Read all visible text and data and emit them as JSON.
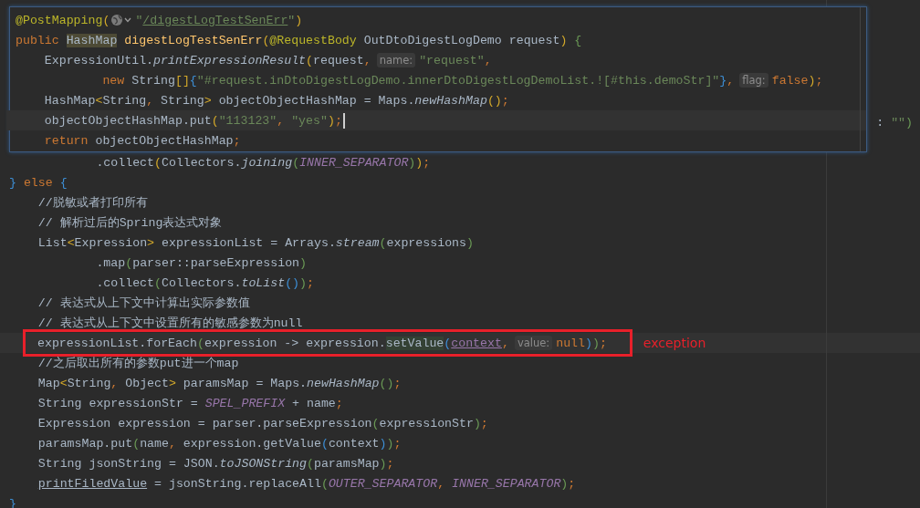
{
  "popup": {
    "lines": [
      {
        "current": false,
        "cursor": false,
        "parts": [
          {
            "kind": "code",
            "tokens": [
              {
                "text": "@PostMapping",
                "kind": "ann"
              },
              {
                "text": "(",
                "kind": "by"
              }
            ]
          },
          {
            "kind": "icon"
          },
          {
            "kind": "code",
            "tokens": [
              {
                "text": "\"",
                "kind": "str"
              },
              {
                "text": "/digestLogTestSenErr",
                "kind": "stru"
              },
              {
                "text": "\"",
                "kind": "str"
              },
              {
                "text": ")",
                "kind": "by"
              }
            ]
          }
        ]
      },
      {
        "current": false,
        "cursor": false,
        "parts": [
          {
            "kind": "code",
            "tokens": [
              {
                "text": "public ",
                "kind": "kw"
              },
              {
                "text": "HashMap",
                "kind": "hl"
              },
              {
                "text": " digestLogTestSenErr",
                "kind": "fn"
              },
              {
                "text": "(",
                "kind": "by"
              },
              {
                "text": "@RequestBody",
                "kind": "ann"
              },
              {
                "text": " OutDtoDigestLogDemo request",
                "kind": "plain"
              },
              {
                "text": ")",
                "kind": "by"
              },
              {
                "text": " {",
                "kind": "bg"
              }
            ]
          }
        ]
      },
      {
        "current": false,
        "cursor": false,
        "parts": [
          {
            "kind": "code",
            "tokens": [
              {
                "text": "    ExpressionUtil.",
                "kind": "plain"
              },
              {
                "text": "printExpressionResult",
                "kind": "it"
              },
              {
                "text": "(",
                "kind": "by"
              },
              {
                "text": "request",
                "kind": "plain"
              },
              {
                "text": ",",
                "kind": "kw"
              }
            ]
          },
          {
            "kind": "hint",
            "text": "name:"
          },
          {
            "kind": "code",
            "tokens": [
              {
                "text": "\"request\"",
                "kind": "str"
              },
              {
                "text": ",",
                "kind": "kw"
              }
            ]
          }
        ]
      },
      {
        "current": false,
        "cursor": false,
        "parts": [
          {
            "kind": "code",
            "tokens": [
              {
                "text": "            new",
                "kind": "kw"
              },
              {
                "text": " String",
                "kind": "plain"
              },
              {
                "text": "[]",
                "kind": "by"
              },
              {
                "text": "{",
                "kind": "bb"
              },
              {
                "text": "\"#request.inDtoDigestLogDemo.innerDtoDigestLogDemoList.![#this.demoStr]\"",
                "kind": "str"
              },
              {
                "text": "}",
                "kind": "bb"
              },
              {
                "text": ",",
                "kind": "kw"
              }
            ]
          },
          {
            "kind": "hint",
            "text": "flag:"
          },
          {
            "kind": "code",
            "tokens": [
              {
                "text": "false",
                "kind": "kw"
              },
              {
                "text": ")",
                "kind": "by"
              },
              {
                "text": ";",
                "kind": "kw"
              }
            ]
          }
        ]
      },
      {
        "current": false,
        "cursor": false,
        "parts": [
          {
            "kind": "code",
            "tokens": [
              {
                "text": "    HashMap",
                "kind": "plain"
              },
              {
                "text": "<",
                "kind": "by"
              },
              {
                "text": "String",
                "kind": "plain"
              },
              {
                "text": ", ",
                "kind": "kw"
              },
              {
                "text": "String",
                "kind": "plain"
              },
              {
                "text": ">",
                "kind": "by"
              },
              {
                "text": " objectObjectHashMap = Maps.",
                "kind": "plain"
              },
              {
                "text": "newHashMap",
                "kind": "it"
              },
              {
                "text": "()",
                "kind": "by"
              },
              {
                "text": ";",
                "kind": "kw"
              }
            ]
          }
        ]
      },
      {
        "current": true,
        "cursor": true,
        "parts": [
          {
            "kind": "code",
            "tokens": [
              {
                "text": "    objectObjectHashMap.put",
                "kind": "plain"
              },
              {
                "text": "(",
                "kind": "by"
              },
              {
                "text": "\"113123\"",
                "kind": "str"
              },
              {
                "text": ", ",
                "kind": "kw"
              },
              {
                "text": "\"yes\"",
                "kind": "str"
              },
              {
                "text": ")",
                "kind": "by"
              },
              {
                "text": ";",
                "kind": "kw"
              }
            ]
          }
        ]
      },
      {
        "current": false,
        "cursor": false,
        "parts": [
          {
            "kind": "code",
            "tokens": [
              {
                "text": "    return",
                "kind": "kw"
              },
              {
                "text": " objectObjectHashMap",
                "kind": "plain"
              },
              {
                "text": ";",
                "kind": "kw"
              }
            ]
          }
        ]
      }
    ]
  },
  "code": [
    {
      "kind": "fragment",
      "current": false,
      "parts": [
        {
          "kind": "code",
          "tokens": [
            {
              "text": ": ",
              "kind": "plain"
            },
            {
              "text": "\"\"",
              "kind": "str"
            },
            {
              "text": ")",
              "kind": "bg"
            }
          ]
        }
      ]
    },
    {
      "kind": "blank",
      "current": false
    },
    {
      "kind": "code",
      "current": false,
      "parts": [
        {
          "kind": "code",
          "tokens": [
            {
              "text": "            .collect",
              "kind": "plain"
            },
            {
              "text": "(",
              "kind": "by"
            },
            {
              "text": "Collectors.",
              "kind": "plain"
            },
            {
              "text": "joining",
              "kind": "it"
            },
            {
              "text": "(",
              "kind": "bg"
            },
            {
              "text": "INNER_SEPARATOR",
              "kind": "const"
            },
            {
              "text": ")",
              "kind": "bg"
            },
            {
              "text": ")",
              "kind": "by"
            },
            {
              "text": ";",
              "kind": "kw"
            }
          ]
        }
      ]
    },
    {
      "kind": "code",
      "current": false,
      "parts": [
        {
          "kind": "code",
          "tokens": [
            {
              "text": "}",
              "kind": "bb"
            },
            {
              "text": " else ",
              "kind": "kw"
            },
            {
              "text": "{",
              "kind": "bb"
            }
          ]
        }
      ]
    },
    {
      "kind": "code",
      "current": false,
      "parts": [
        {
          "kind": "code",
          "tokens": [
            {
              "text": "    //脱敏或者打印所有",
              "kind": "cmt"
            }
          ]
        }
      ]
    },
    {
      "kind": "code",
      "current": false,
      "parts": [
        {
          "kind": "code",
          "tokens": [
            {
              "text": "    // 解析过后的Spring表达式对象",
              "kind": "cmt"
            }
          ]
        }
      ]
    },
    {
      "kind": "code",
      "current": false,
      "parts": [
        {
          "kind": "code",
          "tokens": [
            {
              "text": "    List",
              "kind": "plain"
            },
            {
              "text": "<",
              "kind": "by"
            },
            {
              "text": "Expression",
              "kind": "plain"
            },
            {
              "text": ">",
              "kind": "by"
            },
            {
              "text": " expressionList = Arrays.",
              "kind": "plain"
            },
            {
              "text": "stream",
              "kind": "it"
            },
            {
              "text": "(",
              "kind": "bg"
            },
            {
              "text": "expressions",
              "kind": "plain"
            },
            {
              "text": ")",
              "kind": "bg"
            }
          ]
        }
      ]
    },
    {
      "kind": "code",
      "current": false,
      "parts": [
        {
          "kind": "code",
          "tokens": [
            {
              "text": "            .map",
              "kind": "plain"
            },
            {
              "text": "(",
              "kind": "bg"
            },
            {
              "text": "parser::parseExpression",
              "kind": "plain"
            },
            {
              "text": ")",
              "kind": "bg"
            }
          ]
        }
      ]
    },
    {
      "kind": "code",
      "current": false,
      "parts": [
        {
          "kind": "code",
          "tokens": [
            {
              "text": "            .collect",
              "kind": "plain"
            },
            {
              "text": "(",
              "kind": "bg"
            },
            {
              "text": "Collectors.",
              "kind": "plain"
            },
            {
              "text": "toList",
              "kind": "it"
            },
            {
              "text": "()",
              "kind": "bb"
            },
            {
              "text": ")",
              "kind": "bg"
            },
            {
              "text": ";",
              "kind": "kw"
            }
          ]
        }
      ]
    },
    {
      "kind": "code",
      "current": false,
      "parts": [
        {
          "kind": "code",
          "tokens": [
            {
              "text": "    // 表达式从上下文中计算出实际参数值",
              "kind": "cmt"
            }
          ]
        }
      ]
    },
    {
      "kind": "code",
      "current": false,
      "parts": [
        {
          "kind": "code",
          "tokens": [
            {
              "text": "    // 表达式从上下文中设置所有的敏感参数为null",
              "kind": "cmt"
            }
          ]
        }
      ]
    },
    {
      "kind": "flagged",
      "current": true,
      "note": "exception",
      "parts": [
        {
          "kind": "code",
          "tokens": [
            {
              "text": "expressionList.forEach",
              "kind": "plain"
            },
            {
              "text": "(",
              "kind": "bg"
            },
            {
              "text": "expression -> expression.",
              "kind": "plain"
            },
            {
              "text": "setValue",
              "kind": "sel"
            },
            {
              "text": "(",
              "kind": "bb"
            },
            {
              "text": "context",
              "kind": "field"
            },
            {
              "text": ",",
              "kind": "kw"
            }
          ]
        },
        {
          "kind": "hint",
          "text": "value:"
        },
        {
          "kind": "code",
          "tokens": [
            {
              "text": "null",
              "kind": "kw"
            },
            {
              "text": ")",
              "kind": "bb"
            },
            {
              "text": ")",
              "kind": "bg"
            },
            {
              "text": ";",
              "kind": "kw"
            }
          ]
        }
      ]
    },
    {
      "kind": "code",
      "current": false,
      "parts": [
        {
          "kind": "code",
          "tokens": [
            {
              "text": "    //之后取出所有的参数put进一个map",
              "kind": "cmt"
            }
          ]
        }
      ]
    },
    {
      "kind": "code",
      "current": false,
      "parts": [
        {
          "kind": "code",
          "tokens": [
            {
              "text": "    Map",
              "kind": "plain"
            },
            {
              "text": "<",
              "kind": "by"
            },
            {
              "text": "String",
              "kind": "plain"
            },
            {
              "text": ", ",
              "kind": "kw"
            },
            {
              "text": "Object",
              "kind": "plain"
            },
            {
              "text": ">",
              "kind": "by"
            },
            {
              "text": " paramsMap = Maps.",
              "kind": "plain"
            },
            {
              "text": "newHashMap",
              "kind": "it"
            },
            {
              "text": "()",
              "kind": "bg"
            },
            {
              "text": ";",
              "kind": "kw"
            }
          ]
        }
      ]
    },
    {
      "kind": "code",
      "current": false,
      "parts": [
        {
          "kind": "code",
          "tokens": [
            {
              "text": "    String expressionStr = ",
              "kind": "plain"
            },
            {
              "text": "SPEL_PREFIX",
              "kind": "const"
            },
            {
              "text": " + name",
              "kind": "plain"
            },
            {
              "text": ";",
              "kind": "kw"
            }
          ]
        }
      ]
    },
    {
      "kind": "code",
      "current": false,
      "parts": [
        {
          "kind": "code",
          "tokens": [
            {
              "text": "    Expression expression = parser.parseExpression",
              "kind": "plain"
            },
            {
              "text": "(",
              "kind": "bg"
            },
            {
              "text": "expressionStr",
              "kind": "plain"
            },
            {
              "text": ")",
              "kind": "bg"
            },
            {
              "text": ";",
              "kind": "kw"
            }
          ]
        }
      ]
    },
    {
      "kind": "code",
      "current": false,
      "parts": [
        {
          "kind": "code",
          "tokens": [
            {
              "text": "    paramsMap.put",
              "kind": "plain"
            },
            {
              "text": "(",
              "kind": "bg"
            },
            {
              "text": "name",
              "kind": "plain"
            },
            {
              "text": ", ",
              "kind": "kw"
            },
            {
              "text": "expression.getValue",
              "kind": "plain"
            },
            {
              "text": "(",
              "kind": "bb"
            },
            {
              "text": "context",
              "kind": "plain"
            },
            {
              "text": ")",
              "kind": "bb"
            },
            {
              "text": ")",
              "kind": "bg"
            },
            {
              "text": ";",
              "kind": "kw"
            }
          ]
        }
      ]
    },
    {
      "kind": "code",
      "current": false,
      "parts": [
        {
          "kind": "code",
          "tokens": [
            {
              "text": "    String jsonString = JSON.",
              "kind": "plain"
            },
            {
              "text": "toJSONString",
              "kind": "it"
            },
            {
              "text": "(",
              "kind": "bg"
            },
            {
              "text": "paramsMap",
              "kind": "plain"
            },
            {
              "text": ")",
              "kind": "bg"
            },
            {
              "text": ";",
              "kind": "kw"
            }
          ]
        }
      ]
    },
    {
      "kind": "code",
      "current": false,
      "parts": [
        {
          "kind": "code",
          "tokens": [
            {
              "text": "    printFiledValue",
              "kind": "ul"
            },
            {
              "text": " = jsonString.replaceAll",
              "kind": "plain"
            },
            {
              "text": "(",
              "kind": "bg"
            },
            {
              "text": "OUTER_SEPARATOR",
              "kind": "const"
            },
            {
              "text": ", ",
              "kind": "kw"
            },
            {
              "text": "INNER_SEPARATOR",
              "kind": "const"
            },
            {
              "text": ")",
              "kind": "bg"
            },
            {
              "text": ";",
              "kind": "kw"
            }
          ]
        }
      ]
    },
    {
      "kind": "code",
      "current": false,
      "parts": [
        {
          "kind": "code",
          "tokens": [
            {
              "text": "}",
              "kind": "bb"
            }
          ]
        }
      ]
    }
  ]
}
